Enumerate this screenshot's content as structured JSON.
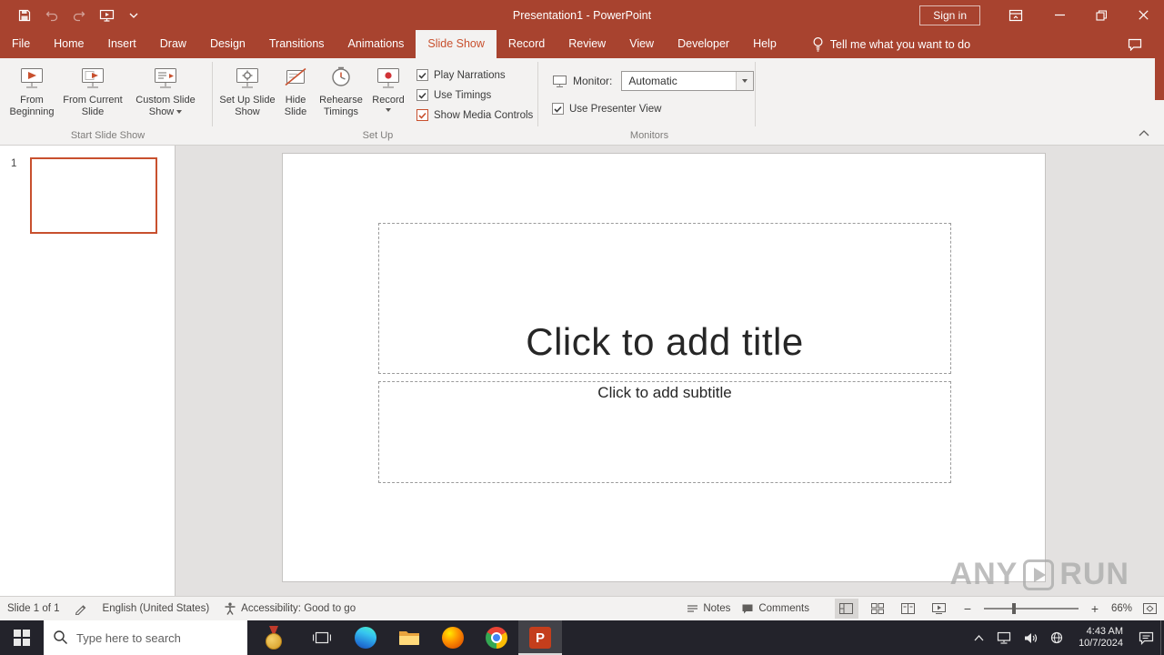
{
  "titlebar": {
    "title": "Presentation1  -  PowerPoint",
    "sign_in": "Sign in"
  },
  "tabs": [
    "File",
    "Home",
    "Insert",
    "Draw",
    "Design",
    "Transitions",
    "Animations",
    "Slide Show",
    "Record",
    "Review",
    "View",
    "Developer",
    "Help"
  ],
  "active_tab": "Slide Show",
  "tell_me": "Tell me what you want to do",
  "ribbon": {
    "start_group": {
      "label": "Start Slide Show",
      "from_beginning": "From Beginning",
      "from_current": "From Current Slide",
      "custom_show": "Custom Slide Show"
    },
    "setup_group": {
      "label": "Set Up",
      "setup_slideshow": "Set Up Slide Show",
      "hide_slide": "Hide Slide",
      "rehearse": "Rehearse Timings",
      "record": "Record",
      "play_narrations": "Play Narrations",
      "use_timings": "Use Timings",
      "show_media_controls": "Show Media Controls"
    },
    "monitors_group": {
      "label": "Monitors",
      "monitor_label": "Monitor:",
      "monitor_value": "Automatic",
      "use_presenter_view": "Use Presenter View"
    }
  },
  "slides_panel": {
    "slide1_number": "1"
  },
  "slide": {
    "title_placeholder": "Click to add title",
    "subtitle_placeholder": "Click to add subtitle"
  },
  "status_bar": {
    "slide_indicator": "Slide 1 of 1",
    "language": "English (United States)",
    "accessibility": "Accessibility: Good to go",
    "notes": "Notes",
    "comments": "Comments",
    "zoom_level": "66%"
  },
  "taskbar": {
    "search_placeholder": "Type here to search",
    "time": "4:43 AM",
    "date": "10/7/2024"
  },
  "watermark": {
    "left": "ANY",
    "right": "RUN"
  },
  "colors": {
    "titlebar_red": "#A8432F",
    "accent_orange": "#C8502E",
    "ribbon_bg": "#F3F2F1",
    "canvas_gray": "#E3E1E0",
    "taskbar_dark": "#23232B"
  }
}
